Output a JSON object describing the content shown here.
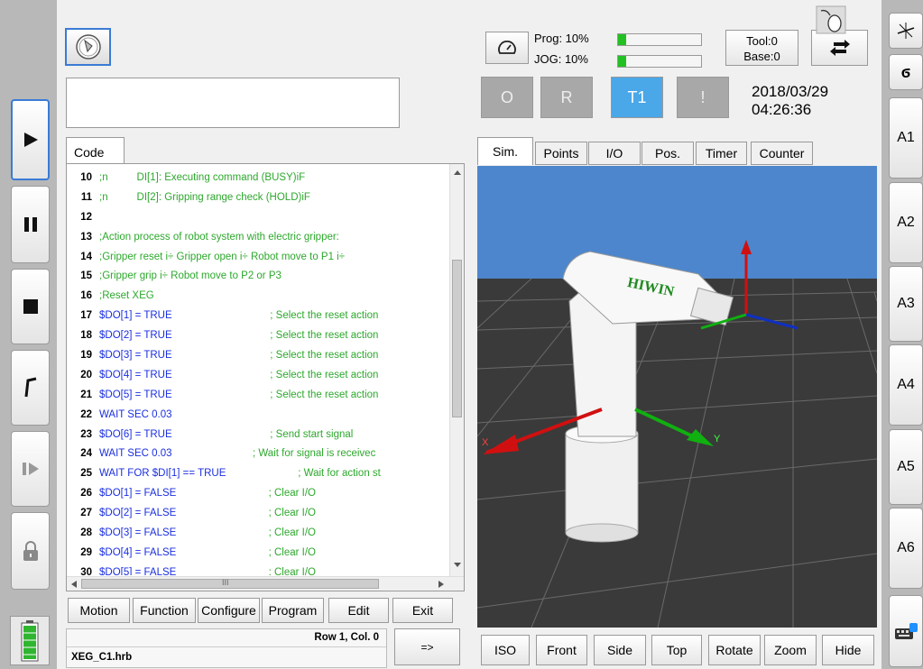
{
  "left_bar": {
    "buttons": [
      {
        "name": "play",
        "glyph": "▶"
      },
      {
        "name": "pause",
        "glyph": "❚❚"
      },
      {
        "name": "stop",
        "glyph": "■"
      },
      {
        "name": "step-back",
        "glyph": "⌐"
      },
      {
        "name": "step-forward",
        "glyph": "❙▶"
      },
      {
        "name": "lock",
        "glyph": "🔒"
      }
    ]
  },
  "right_bar": {
    "axes": [
      "A1",
      "A2",
      "A3",
      "A4",
      "A5",
      "A6"
    ]
  },
  "code_panel": {
    "tab_label": "Code",
    "lines": [
      {
        "n": "10",
        "parts": [
          {
            "t": ";n          DI[1]: Executing command (BUSY)iF",
            "c": "cm"
          }
        ]
      },
      {
        "n": "11",
        "parts": [
          {
            "t": ";n          DI[2]: Gripping range check (HOLD)iF",
            "c": "cm"
          }
        ]
      },
      {
        "n": "12",
        "parts": []
      },
      {
        "n": "13",
        "parts": [
          {
            "t": ";Action process of robot system with electric gripper:",
            "c": "cm"
          }
        ]
      },
      {
        "n": "14",
        "parts": [
          {
            "t": ";Gripper reset i÷ Gripper open i÷ Robot move to P1 i÷",
            "c": "cm"
          }
        ]
      },
      {
        "n": "15",
        "parts": [
          {
            "t": ";Gripper grip i÷ Robot move to P2 or P3",
            "c": "cm"
          }
        ]
      },
      {
        "n": "16",
        "parts": [
          {
            "t": ";Reset XEG",
            "c": "cm"
          }
        ]
      },
      {
        "n": "17",
        "parts": [
          {
            "t": "$DO[1] = TRUE",
            "c": "kw"
          },
          {
            "t": "                                  ; Select the reset action",
            "c": "cm"
          }
        ]
      },
      {
        "n": "18",
        "parts": [
          {
            "t": "$DO[2] = TRUE",
            "c": "kw"
          },
          {
            "t": "                                  ; Select the reset action",
            "c": "cm"
          }
        ]
      },
      {
        "n": "19",
        "parts": [
          {
            "t": "$DO[3] = TRUE",
            "c": "kw"
          },
          {
            "t": "                                  ; Select the reset action",
            "c": "cm"
          }
        ]
      },
      {
        "n": "20",
        "parts": [
          {
            "t": "$DO[4] = TRUE",
            "c": "kw"
          },
          {
            "t": "                                  ; Select the reset action",
            "c": "cm"
          }
        ]
      },
      {
        "n": "21",
        "parts": [
          {
            "t": "$DO[5] = TRUE",
            "c": "kw"
          },
          {
            "t": "                                  ; Select the reset action",
            "c": "cm"
          }
        ]
      },
      {
        "n": "22",
        "parts": [
          {
            "t": "WAIT SEC 0.03",
            "c": "kw"
          }
        ]
      },
      {
        "n": "23",
        "parts": [
          {
            "t": "$DO[6] = TRUE",
            "c": "kw"
          },
          {
            "t": "                                  ; Send start signal",
            "c": "cm"
          }
        ]
      },
      {
        "n": "24",
        "parts": [
          {
            "t": "WAIT SEC 0.03",
            "c": "kw"
          },
          {
            "t": "                            ; Wait for signal is receivec",
            "c": "cm"
          }
        ]
      },
      {
        "n": "25",
        "parts": [
          {
            "t": "WAIT FOR $DI[1] == TRUE",
            "c": "kw"
          },
          {
            "t": "                         ; Wait for action st",
            "c": "cm"
          }
        ]
      },
      {
        "n": "26",
        "parts": [
          {
            "t": "$DO[1] = FALSE",
            "c": "kw"
          },
          {
            "t": "                                ; Clear I/O",
            "c": "cm"
          }
        ]
      },
      {
        "n": "27",
        "parts": [
          {
            "t": "$DO[2] = FALSE",
            "c": "kw"
          },
          {
            "t": "                                ; Clear I/O",
            "c": "cm"
          }
        ]
      },
      {
        "n": "28",
        "parts": [
          {
            "t": "$DO[3] = FALSE",
            "c": "kw"
          },
          {
            "t": "                                ; Clear I/O",
            "c": "cm"
          }
        ]
      },
      {
        "n": "29",
        "parts": [
          {
            "t": "$DO[4] = FALSE",
            "c": "kw"
          },
          {
            "t": "                                ; Clear I/O",
            "c": "cm"
          }
        ]
      },
      {
        "n": "30",
        "parts": [
          {
            "t": "$DO[5] = FALSE",
            "c": "kw"
          },
          {
            "t": "                                ; Clear I/O",
            "c": "cm"
          }
        ]
      }
    ],
    "scroll_marker": "III",
    "menu": [
      "Motion",
      "Function",
      "Configure",
      "Program",
      "Edit",
      "Exit"
    ],
    "cursor_pos": "Row 1, Col. 0",
    "file_name": "XEG_C1.hrb",
    "arrow_label": "=>"
  },
  "status": {
    "prog_label": "Prog: 10%",
    "jog_label": "JOG: 10%",
    "prog_percent": 10,
    "jog_percent": 10,
    "tool_label": "Tool:0",
    "base_label": "Base:0",
    "modes": [
      "O",
      "R",
      "T1",
      "!"
    ],
    "active_mode": "T1",
    "date": "2018/03/29",
    "time": "04:26:36"
  },
  "sim_panel": {
    "tabs": [
      "Sim.",
      "Points",
      "I/O",
      "Pos.",
      "Timer",
      "Counter"
    ],
    "active_tab": "Sim.",
    "robot_brand": "HIWIN",
    "axis_labels": {
      "x": "X",
      "y": "Y",
      "z": "Z"
    },
    "view_buttons": [
      "ISO",
      "Front",
      "Side",
      "Top",
      "Rotate",
      "Zoom",
      "Hide"
    ],
    "sky_color": "#4d86cc",
    "floor_color": "#3a3a3a"
  }
}
